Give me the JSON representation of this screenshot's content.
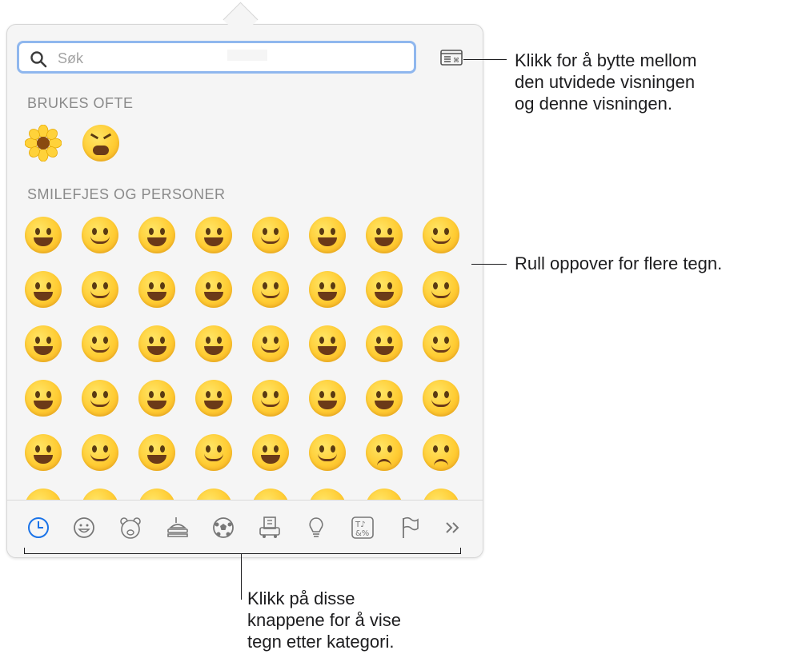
{
  "search": {
    "placeholder": "Søk"
  },
  "sections": {
    "frequent": "BRUKES OFTE",
    "smileys": "SMILEFJES OG PERSONER"
  },
  "categories": [
    "recent",
    "smileys",
    "animals",
    "food",
    "activity",
    "travel",
    "objects",
    "symbols",
    "flags",
    "more"
  ],
  "callouts": {
    "toggle": [
      "Klikk for å bytte mellom",
      "den utvidede visningen",
      "og denne visningen."
    ],
    "scroll": "Rull oppover for flere tegn.",
    "categories": [
      "Klikk på disse",
      "knappene for å vise",
      "tegn etter kategori."
    ]
  },
  "colors": {
    "accent": "#1a73e8",
    "search_ring": "#8fb7ee",
    "label": "#8a8a8a"
  }
}
